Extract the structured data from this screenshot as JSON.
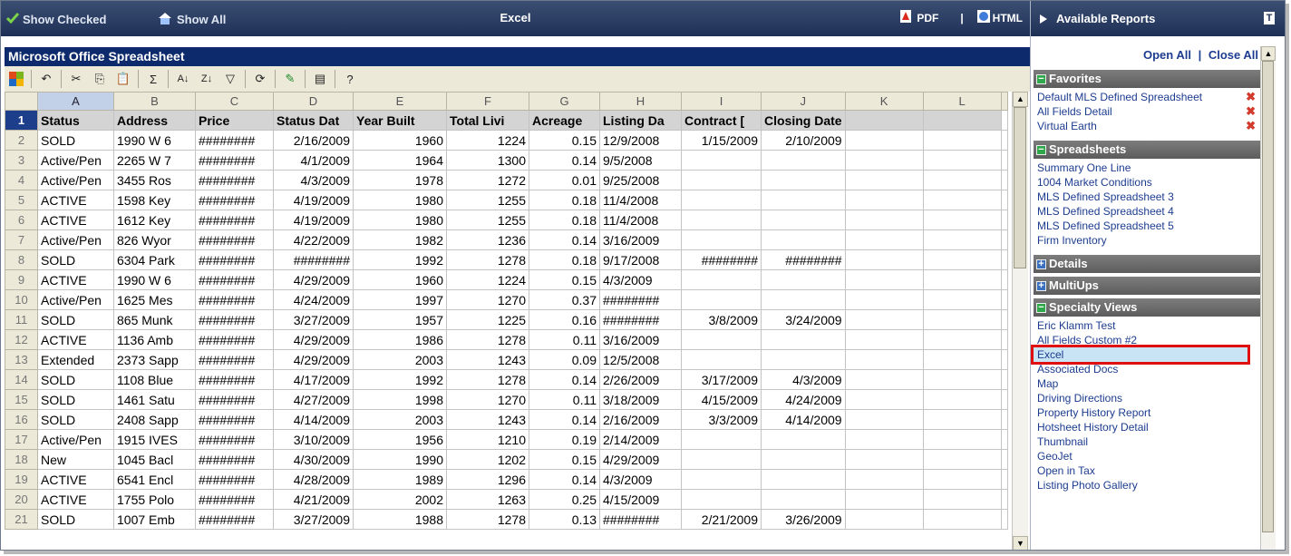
{
  "toolbar": {
    "show_checked": "Show Checked",
    "show_all": "Show All",
    "title": "Excel",
    "pdf": "PDF",
    "separator": "|",
    "html": "HTML"
  },
  "spreadsheet": {
    "title": "Microsoft Office Spreadsheet",
    "columns": [
      "A",
      "B",
      "C",
      "D",
      "E",
      "F",
      "G",
      "H",
      "I",
      "J",
      "K",
      "L"
    ],
    "rows": [
      [
        "Status",
        "Address",
        "Price",
        "Status Dat",
        "Year Built",
        "Total Livi",
        "Acreage",
        "Listing Da",
        "Contract [",
        "Closing Date",
        "",
        ""
      ],
      [
        "SOLD",
        "1990  W 6",
        "########",
        "2/16/2009",
        "1960",
        "1224",
        "0.15",
        "12/9/2008",
        "1/15/2009",
        "2/10/2009",
        "",
        ""
      ],
      [
        "Active/Pen",
        "2265  W 7",
        "########",
        "4/1/2009",
        "1964",
        "1300",
        "0.14",
        "9/5/2008",
        "",
        "",
        "",
        ""
      ],
      [
        "Active/Pen",
        "3455  Ros",
        "########",
        "4/3/2009",
        "1978",
        "1272",
        "0.01",
        "9/25/2008",
        "",
        "",
        "",
        ""
      ],
      [
        "ACTIVE",
        "1598  Key",
        "########",
        "4/19/2009",
        "1980",
        "1255",
        "0.18",
        "11/4/2008",
        "",
        "",
        "",
        ""
      ],
      [
        "ACTIVE",
        "1612  Key",
        "########",
        "4/19/2009",
        "1980",
        "1255",
        "0.18",
        "11/4/2008",
        "",
        "",
        "",
        ""
      ],
      [
        "Active/Pen",
        "826  Wyor",
        "########",
        "4/22/2009",
        "1982",
        "1236",
        "0.14",
        "3/16/2009",
        "",
        "",
        "",
        ""
      ],
      [
        "SOLD",
        "6304  Park",
        "########",
        "########",
        "1992",
        "1278",
        "0.18",
        "9/17/2008",
        "########",
        "########",
        "",
        ""
      ],
      [
        "ACTIVE",
        "1990  W 6",
        "########",
        "4/29/2009",
        "1960",
        "1224",
        "0.15",
        "4/3/2009",
        "",
        "",
        "",
        ""
      ],
      [
        "Active/Pen",
        "1625  Mes",
        "########",
        "4/24/2009",
        "1997",
        "1270",
        "0.37",
        "########",
        "",
        "",
        "",
        ""
      ],
      [
        "SOLD",
        "865  Munk",
        "########",
        "3/27/2009",
        "1957",
        "1225",
        "0.16",
        "########",
        "3/8/2009",
        "3/24/2009",
        "",
        ""
      ],
      [
        "ACTIVE",
        "1136  Amb",
        "########",
        "4/29/2009",
        "1986",
        "1278",
        "0.11",
        "3/16/2009",
        "",
        "",
        "",
        ""
      ],
      [
        "Extended",
        "2373  Sapp",
        "########",
        "4/29/2009",
        "2003",
        "1243",
        "0.09",
        "12/5/2008",
        "",
        "",
        "",
        ""
      ],
      [
        "SOLD",
        "1108  Blue",
        "########",
        "4/17/2009",
        "1992",
        "1278",
        "0.14",
        "2/26/2009",
        "3/17/2009",
        "4/3/2009",
        "",
        ""
      ],
      [
        "SOLD",
        "1461  Satu",
        "########",
        "4/27/2009",
        "1998",
        "1270",
        "0.11",
        "3/18/2009",
        "4/15/2009",
        "4/24/2009",
        "",
        ""
      ],
      [
        "SOLD",
        "2408  Sapp",
        "########",
        "4/14/2009",
        "2003",
        "1243",
        "0.14",
        "2/16/2009",
        "3/3/2009",
        "4/14/2009",
        "",
        ""
      ],
      [
        "Active/Pen",
        "1915  IVES",
        "########",
        "3/10/2009",
        "1956",
        "1210",
        "0.19",
        "2/14/2009",
        "",
        "",
        "",
        ""
      ],
      [
        "New",
        "1045  Bacl",
        "########",
        "4/30/2009",
        "1990",
        "1202",
        "0.15",
        "4/29/2009",
        "",
        "",
        "",
        ""
      ],
      [
        "ACTIVE",
        "6541  Encl",
        "########",
        "4/28/2009",
        "1989",
        "1296",
        "0.14",
        "4/3/2009",
        "",
        "",
        "",
        ""
      ],
      [
        "ACTIVE",
        "1755  Polo",
        "########",
        "4/21/2009",
        "2002",
        "1263",
        "0.25",
        "4/15/2009",
        "",
        "",
        "",
        ""
      ],
      [
        "SOLD",
        "1007  Emb",
        "########",
        "3/27/2009",
        "1988",
        "1278",
        "0.13",
        "########",
        "2/21/2009",
        "3/26/2009",
        "",
        ""
      ]
    ]
  },
  "panel": {
    "title": "Available Reports",
    "open_all": "Open All",
    "divider": "|",
    "close_all": "Close All",
    "sections": [
      {
        "title": "Favorites",
        "expanded": true,
        "items": [
          "Default MLS Defined Spreadsheet",
          "All Fields Detail",
          "Virtual Earth"
        ]
      },
      {
        "title": "Spreadsheets",
        "expanded": true,
        "items": [
          "Summary One Line",
          "1004 Market Conditions",
          "MLS Defined Spreadsheet 3",
          "MLS Defined Spreadsheet 4",
          "MLS Defined Spreadsheet 5",
          "Firm Inventory"
        ]
      },
      {
        "title": "Details",
        "expanded": false,
        "items": []
      },
      {
        "title": "MultiUps",
        "expanded": false,
        "items": []
      },
      {
        "title": "Specialty Views",
        "expanded": true,
        "items": [
          "Eric Klamm Test",
          "All Fields Custom #2",
          "Excel",
          "Associated Docs",
          "Map",
          "Driving Directions",
          "Property History Report",
          "Hotsheet History Detail",
          "Thumbnail",
          "GeoJet",
          "Open in Tax",
          "Listing Photo Gallery"
        ]
      }
    ],
    "highlighted": "Excel"
  },
  "colors": {
    "accent": "#1f3057",
    "link": "#1c3c8f",
    "highlight_box": "#e01010"
  }
}
